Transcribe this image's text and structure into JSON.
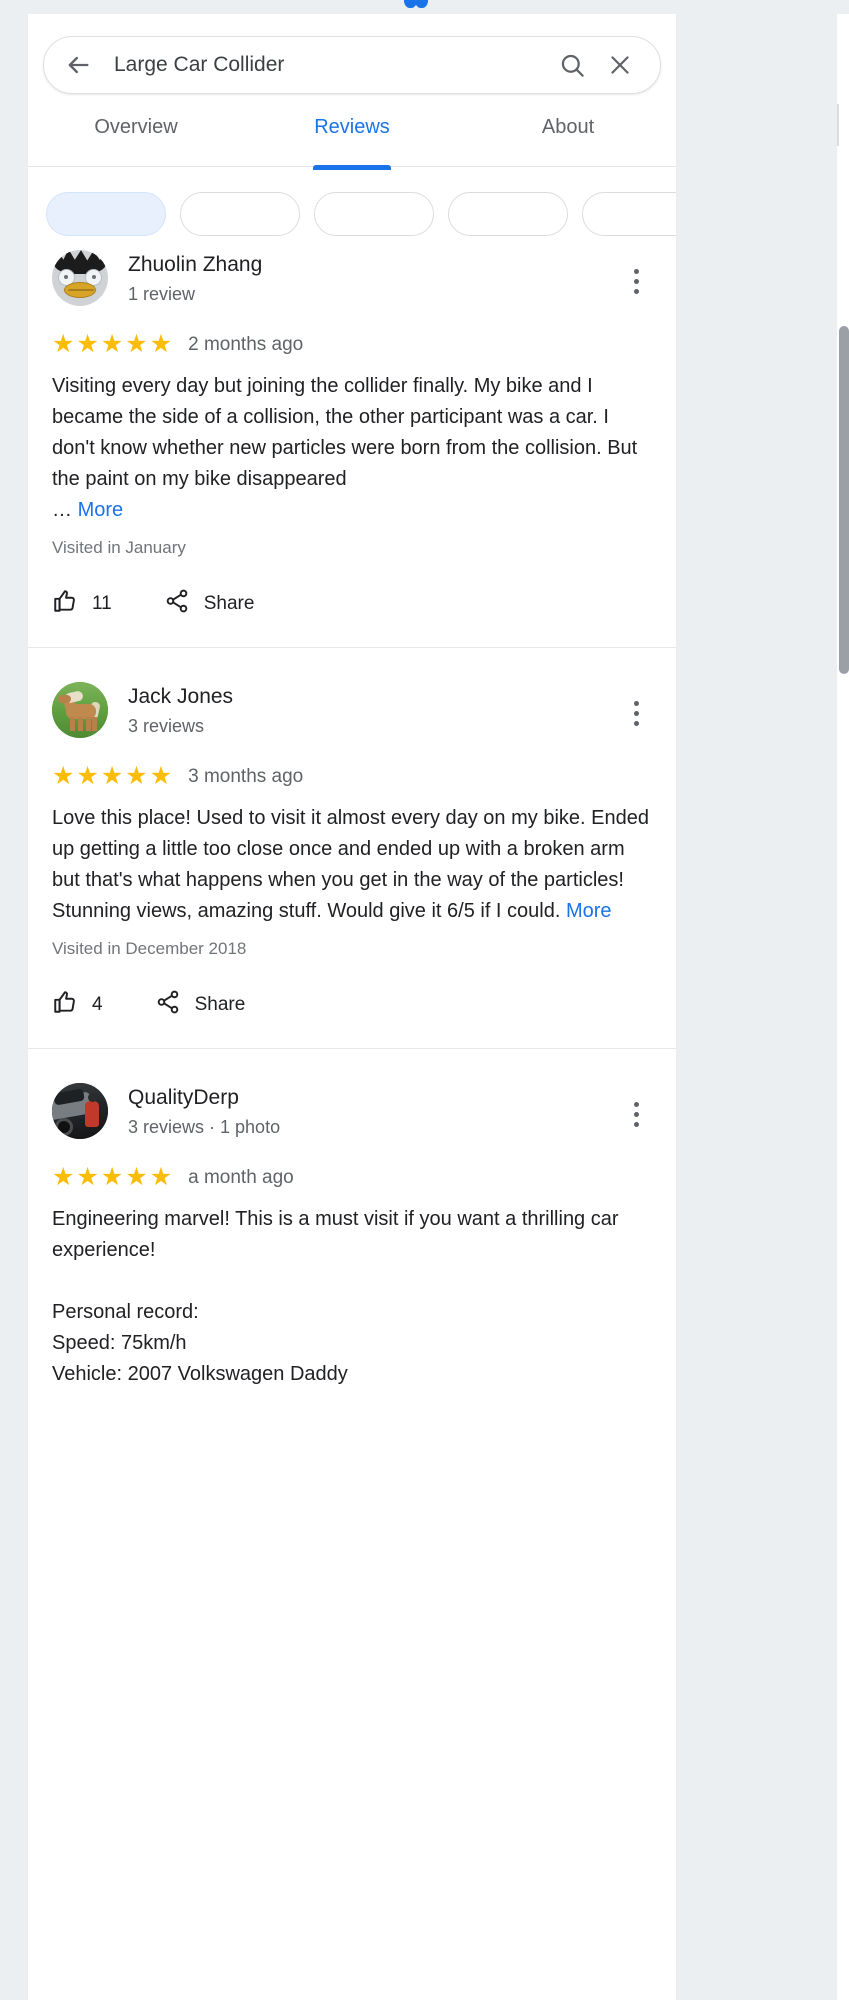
{
  "window": {
    "bleed_label": "",
    "background_color": "#eceff1"
  },
  "search": {
    "value": "Large Car Collider",
    "placeholder": "Search",
    "back_icon": "arrow-back-icon",
    "search_icon": "search-icon",
    "clear_icon": "close-icon"
  },
  "tabs": [
    {
      "label": "Overview",
      "active": false
    },
    {
      "label": "Reviews",
      "active": true
    },
    {
      "label": "About",
      "active": false
    }
  ],
  "theme": {
    "accent": "#1a73e8",
    "star": "#fbbc04",
    "text_primary": "#202124",
    "text_secondary": "#5f6368",
    "divider": "#e8e8e8"
  },
  "actions": {
    "like_icon": "thumb-up-icon",
    "share_icon": "share-icon",
    "share_label": "Share",
    "more_label": "More",
    "ellipsis": "… ",
    "menu_icon": "overflow-menu-icon"
  },
  "reviews": [
    {
      "author": "Zhuolin Zhang",
      "meta": "1 review",
      "avatar": "derp-bird-avatar",
      "rating": 5,
      "age": "2 months ago",
      "text": "Visiting every day but joining the collider finally. My bike and I became the side of a collision, the other participant was a car. I don't know whether new particles were born from the collision. But the paint on my bike disappeared",
      "truncated": true,
      "visited": "Visited in January",
      "likes": "11"
    },
    {
      "author": "Jack Jones",
      "meta": "3 reviews",
      "avatar": "horse-avatar",
      "rating": 5,
      "age": "3 months ago",
      "text": "Love this place! Used to visit it almost every day on my bike. Ended up getting a little too close once and ended up with a broken arm but that's what happens when you get in the way of the particles! Stunning views, amazing stuff. Would give it 6/5 if I could.",
      "truncated": false,
      "visited": "Visited in December 2018",
      "likes": "4"
    },
    {
      "author": "QualityDerp",
      "meta": "3 reviews · 1 photo",
      "avatar": "car-avatar",
      "rating": 5,
      "age": "a month ago",
      "text": "Engineering marvel! This is a must visit if you want a thrilling car experience!\n\nPersonal record:\nSpeed: 75km/h\nVehicle: 2007 Volkswagen Daddy",
      "truncated": false,
      "visited": "",
      "likes": ""
    }
  ],
  "scrollbar": {
    "name": "vertical-scrollbar"
  }
}
